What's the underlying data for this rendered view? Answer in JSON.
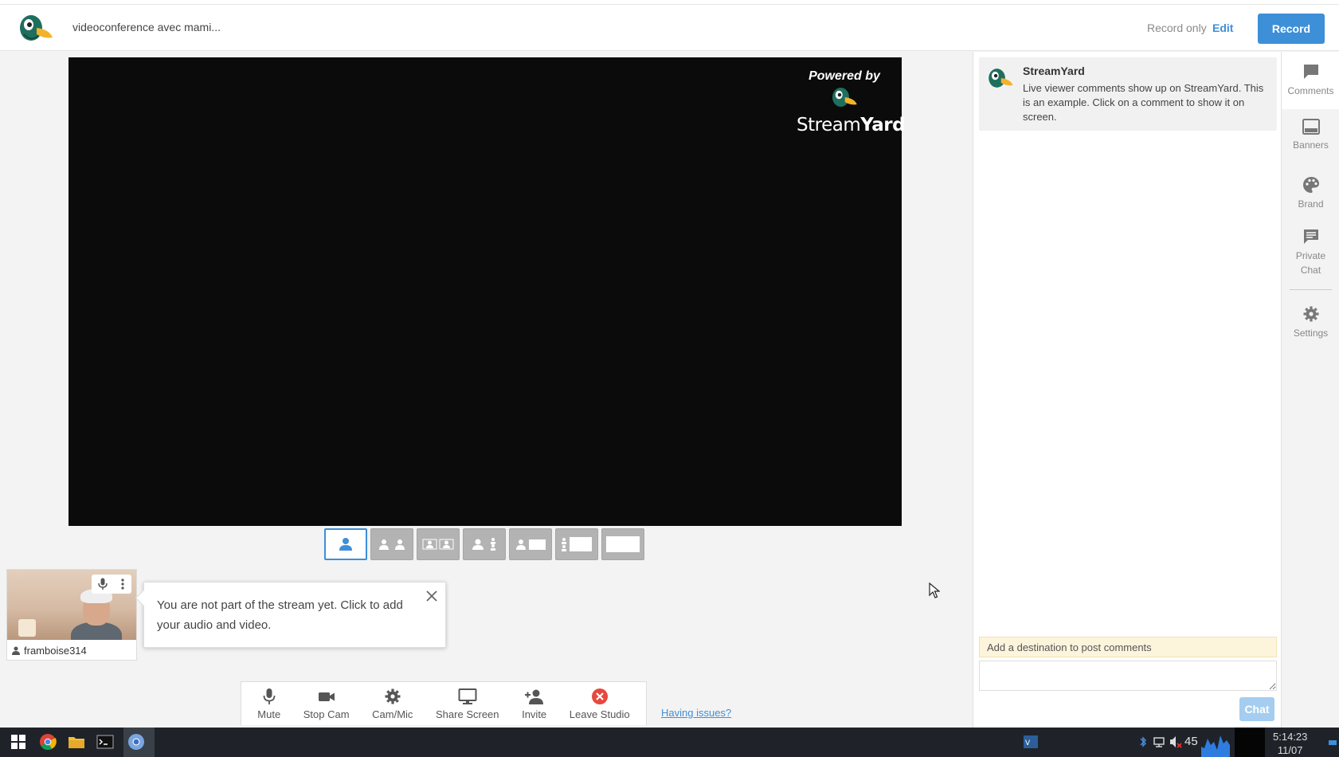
{
  "header": {
    "title": "videoconference avec mami...",
    "record_only_label": "Record only",
    "edit_label": "Edit",
    "record_label": "Record"
  },
  "stage": {
    "powered_by": "Powered by",
    "brand_stream": "Stream",
    "brand_yard": "Yard"
  },
  "layouts": [
    {
      "name": "solo",
      "active": true
    },
    {
      "name": "two-side",
      "active": false
    },
    {
      "name": "grid",
      "active": false
    },
    {
      "name": "leader",
      "active": false
    },
    {
      "name": "screen-small",
      "active": false
    },
    {
      "name": "screen-thin",
      "active": false
    },
    {
      "name": "screen-full",
      "active": false
    }
  ],
  "participant": {
    "name": "framboise314"
  },
  "tooltip": {
    "text": "You are not part of the stream yet. Click to add your audio and video."
  },
  "toolbar": {
    "mute": "Mute",
    "stop_cam": "Stop Cam",
    "cam_mic": "Cam/Mic",
    "share_screen": "Share Screen",
    "invite": "Invite",
    "leave": "Leave Studio",
    "issues": "Having issues?"
  },
  "comments": {
    "items": [
      {
        "author": "StreamYard",
        "text": "Live viewer comments show up on StreamYard. This is an example. Click on a comment to show it on screen."
      }
    ],
    "destination_notice": "Add a destination to post comments",
    "chat_label": "Chat"
  },
  "sidetabs": {
    "comments": "Comments",
    "banners": "Banners",
    "brand": "Brand",
    "private_chat_1": "Private",
    "private_chat_2": "Chat",
    "settings": "Settings"
  },
  "taskbar": {
    "tray_number": "45",
    "time": "5:14:23",
    "date": "11/07"
  },
  "colors": {
    "accent": "#3d8fd8",
    "stage_bg": "#0b0b0b",
    "leave": "#e8473f"
  }
}
